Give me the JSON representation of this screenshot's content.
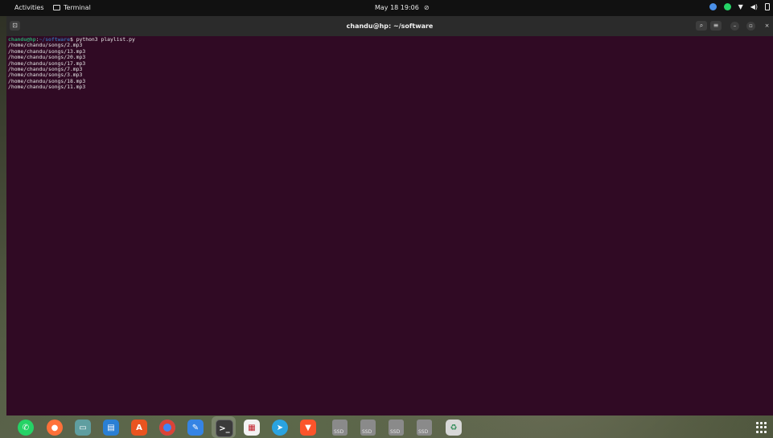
{
  "topbar": {
    "activities": "Activities",
    "app_name": "Terminal",
    "clock": "May 18 19:06",
    "mute_icon": "mic-muted-icon",
    "tray": [
      "chrome-tray-icon",
      "whatsapp-tray-icon",
      "wifi-icon",
      "volume-icon",
      "battery-icon"
    ]
  },
  "window": {
    "title": "chandu@hp: ~/software",
    "buttons": [
      "new-tab-button",
      "search-button",
      "menu-button",
      "minimize-button",
      "maximize-button",
      "close-button"
    ]
  },
  "terminal": {
    "prompt_user": "chandu@hp",
    "prompt_sep": ":",
    "prompt_path": "~/software",
    "prompt_symbol": "$ ",
    "command": "python3 playlist.py",
    "output": [
      "/home/chandu/songs/2.mp3",
      "/home/chandu/songs/13.mp3",
      "/home/chandu/songs/20.mp3",
      "/home/chandu/songs/17.mp3",
      "/home/chandu/songs/7.mp3",
      "/home/chandu/songs/3.mp3",
      "/home/chandu/songs/18.mp3",
      "/home/chandu/songs/11.mp3"
    ]
  },
  "dock": {
    "apps": [
      {
        "name": "whatsapp-icon",
        "color": "#25d366"
      },
      {
        "name": "firefox-icon",
        "color": "#ff7139"
      },
      {
        "name": "files-icon",
        "color": "#5f9ea0"
      },
      {
        "name": "libreoffice-writer-icon",
        "color": "#2a7fd4"
      },
      {
        "name": "app-center-icon",
        "color": "#e95420"
      },
      {
        "name": "chrome-icon",
        "color": "#4285f4"
      },
      {
        "name": "text-editor-icon",
        "color": "#3584e4"
      },
      {
        "name": "terminal-icon",
        "color": "#3a3a3a"
      },
      {
        "name": "document-viewer-icon",
        "color": "#c01c28"
      },
      {
        "name": "telegram-icon",
        "color": "#2aa3e0"
      },
      {
        "name": "brave-icon",
        "color": "#fb542b"
      }
    ],
    "drives": [
      "SSD",
      "SSD",
      "SSD",
      "SSD"
    ],
    "trash": "trash-icon",
    "show_apps": "show-apps-icon"
  }
}
